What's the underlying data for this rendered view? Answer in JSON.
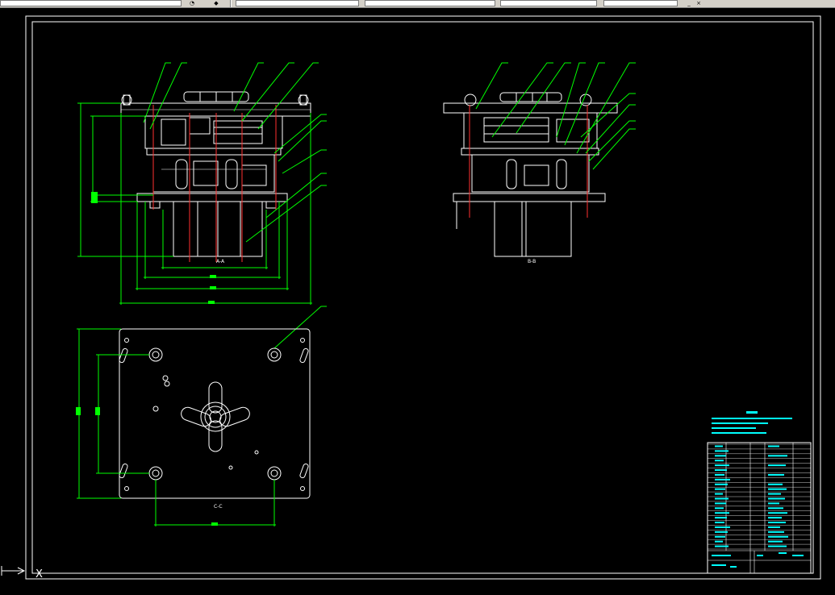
{
  "toolbar": {
    "layer_value": "",
    "style_value": "",
    "color_value": "",
    "linetype_value": "",
    "lineweight_value": "",
    "window_buttons": [
      "_",
      "×"
    ]
  },
  "drawing": {
    "views": [
      {
        "label": "A-A"
      },
      {
        "label": "B-B"
      },
      {
        "label": "C-C"
      }
    ],
    "ucs_axis_label": "X",
    "colors": {
      "background": "#000000",
      "part_lines": "#ffffff",
      "dimension_lines": "#00ff00",
      "center_lines": "#ff3030",
      "title_block": "#00ffff",
      "frame": "#ffffff"
    }
  }
}
